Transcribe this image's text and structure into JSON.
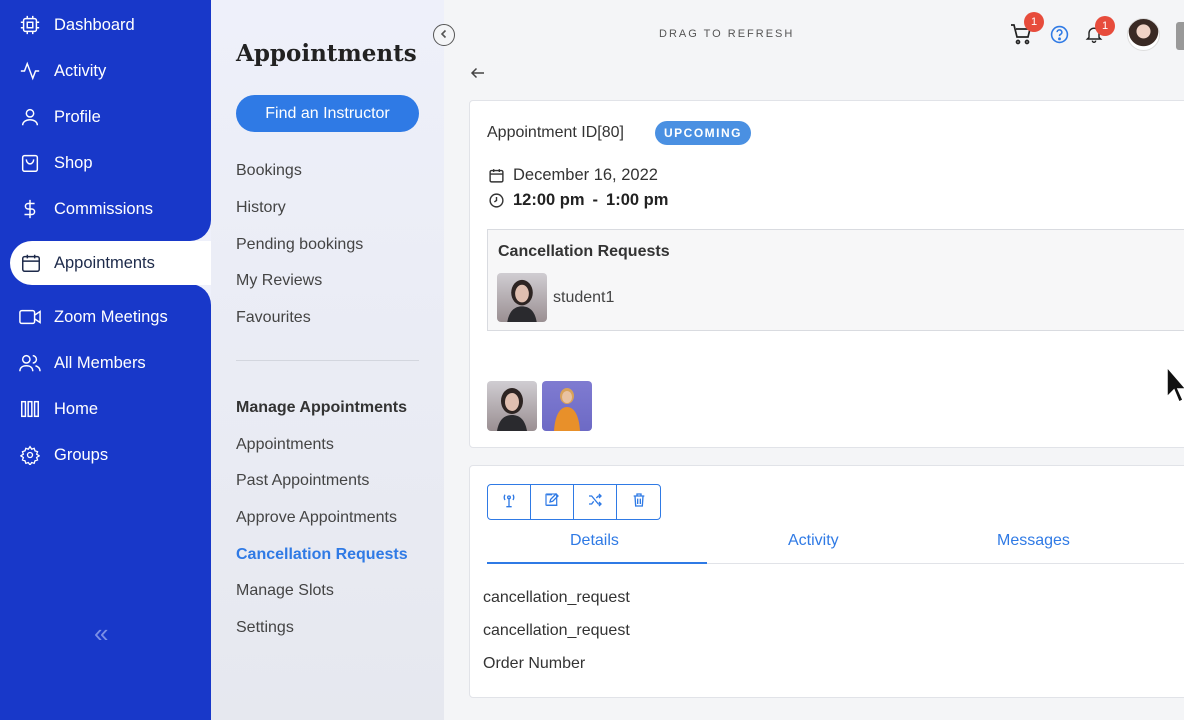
{
  "nav": {
    "items": [
      {
        "label": "Dashboard",
        "icon": "chip-icon"
      },
      {
        "label": "Activity",
        "icon": "pulse-icon"
      },
      {
        "label": "Profile",
        "icon": "user-icon"
      },
      {
        "label": "Shop",
        "icon": "bag-icon"
      },
      {
        "label": "Commissions",
        "icon": "dollar-icon"
      },
      {
        "label": "Appointments",
        "icon": "calendar-icon",
        "active": true
      },
      {
        "label": "Zoom Meetings",
        "icon": "video-icon"
      },
      {
        "label": "All Members",
        "icon": "users-icon"
      },
      {
        "label": "Home",
        "icon": "columns-icon"
      },
      {
        "label": "Groups",
        "icon": "gear-icon"
      }
    ],
    "collapse_glyph": "«"
  },
  "sub": {
    "title": "Appointments",
    "find_button": "Find an Instructor",
    "links": [
      "Bookings",
      "History",
      "Pending bookings",
      "My Reviews",
      "Favourites"
    ],
    "manage_heading": "Manage Appointments",
    "manage_links": [
      "Appointments",
      "Past Appointments",
      "Approve Appointments",
      "Cancellation Requests",
      "Manage Slots",
      "Settings"
    ]
  },
  "header": {
    "drag_text": "DRAG TO REFRESH",
    "cart_badge": "1",
    "notif_badge": "1"
  },
  "appointment": {
    "id_label": "Appointment ID[80]",
    "status": "UPCOMING",
    "date": "December 16, 2022",
    "start": "12:00 pm",
    "sep": "-",
    "end": "1:00 pm",
    "cancellation_title": "Cancellation Requests",
    "student_name": "student1"
  },
  "tabs": [
    "Details",
    "Activity",
    "Messages"
  ],
  "details": [
    "cancellation_request",
    "cancellation_request",
    "Order Number"
  ],
  "colors": {
    "nav_bg": "#1838c9",
    "accent": "#2f7ae5",
    "badge": "#e74c3c",
    "status": "#4a90e2"
  }
}
